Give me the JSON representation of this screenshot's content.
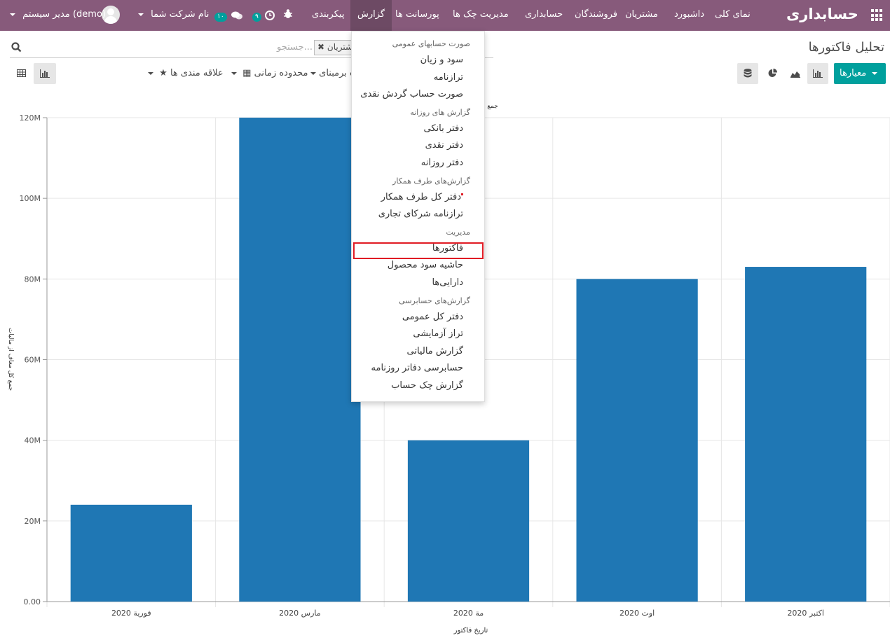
{
  "app": {
    "brand": "حسابداری",
    "colors": {
      "topbar": "#875a7b",
      "active_menu": "#6d4a64",
      "primary": "#00a09d",
      "bar": "#1f77b4",
      "highlight": "#e01b24"
    }
  },
  "topbar": {
    "menus": [
      "نمای کلی",
      "داشبورد",
      "مشتریان",
      "فروشندگان",
      "حسابداری",
      "مدیریت چک ها",
      "پورسانت ها",
      "گزارش",
      "پیکربندی"
    ],
    "active_menu": "گزارش",
    "activity_count": "۹",
    "message_count": "۱۰",
    "company": "نام شرکت شما",
    "user": "مدیر سیستم (demo)"
  },
  "page": {
    "title": "تحلیل فاکتورها",
    "search_facet": "شتریان",
    "search_placeholder": "جستجو...",
    "measures_button": "معیارها",
    "filters": {
      "groupby": "ه برمبنای",
      "time_range": "محدوده زمانی",
      "favorites": "علاقه مندی ها"
    },
    "measure_label_partial": "جمع"
  },
  "dropdown": {
    "sections": [
      {
        "header": "صورت حسابهای عمومی",
        "items": [
          "سود و زیان",
          "ترازنامه",
          "صورت حساب گردش نقدی"
        ]
      },
      {
        "header": "گزارش های روزانه",
        "items": [
          "دفتر بانکی",
          "دفتر نقدی",
          "دفتر روزانه"
        ]
      },
      {
        "header": "گزارش‌های طرف همکار",
        "items": [
          "دفتر کل طرف همکار",
          "ترازنامه شرکای تجاری"
        ]
      },
      {
        "header": "مدیریت",
        "items": [
          "فاکتورها",
          "حاشیه سود محصول",
          "دارایی‌ها"
        ]
      },
      {
        "header": "گزارش‌های حسابرسی",
        "items": [
          "دفتر کل عمومی",
          "تراز آزمایشی",
          "گزارش مالیاتی",
          "حسابرسی دفاتر روزنامه",
          "گزارش چک حساب"
        ]
      }
    ],
    "highlighted_item": "فاکتورها"
  },
  "chart_data": {
    "type": "bar",
    "categories": [
      "فورية 2020",
      "مارس 2020",
      "مة 2020",
      "اوت 2020",
      "اکتبر 2020"
    ],
    "values": [
      24000000,
      120000000,
      40000000,
      80000000,
      83000000
    ],
    "ylim": [
      0,
      120000000
    ],
    "yticks": [
      "0.00",
      "20M",
      "40M",
      "60M",
      "80M",
      "100M",
      "120M"
    ],
    "xlabel": "تاریخ فاکتور",
    "ylabel": "جمع کل معاف از مالیات",
    "grid": true,
    "bar_color": "#1f77b4"
  }
}
